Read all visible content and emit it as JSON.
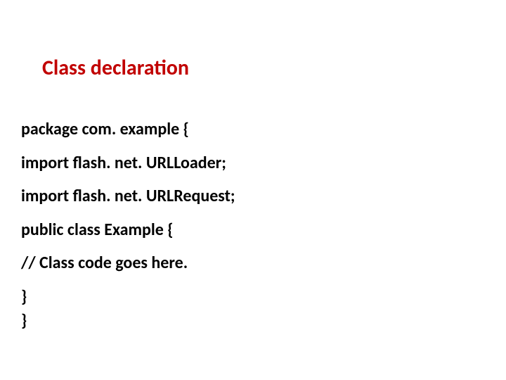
{
  "title": "Class declaration",
  "code": {
    "line1": "package com. example {",
    "line2": "import flash. net. URLLoader;",
    "line3": "import flash. net. URLRequest;",
    "line4": "public class Example {",
    "line5": "// Class code goes here.",
    "line6": "}",
    "line7": "}"
  }
}
